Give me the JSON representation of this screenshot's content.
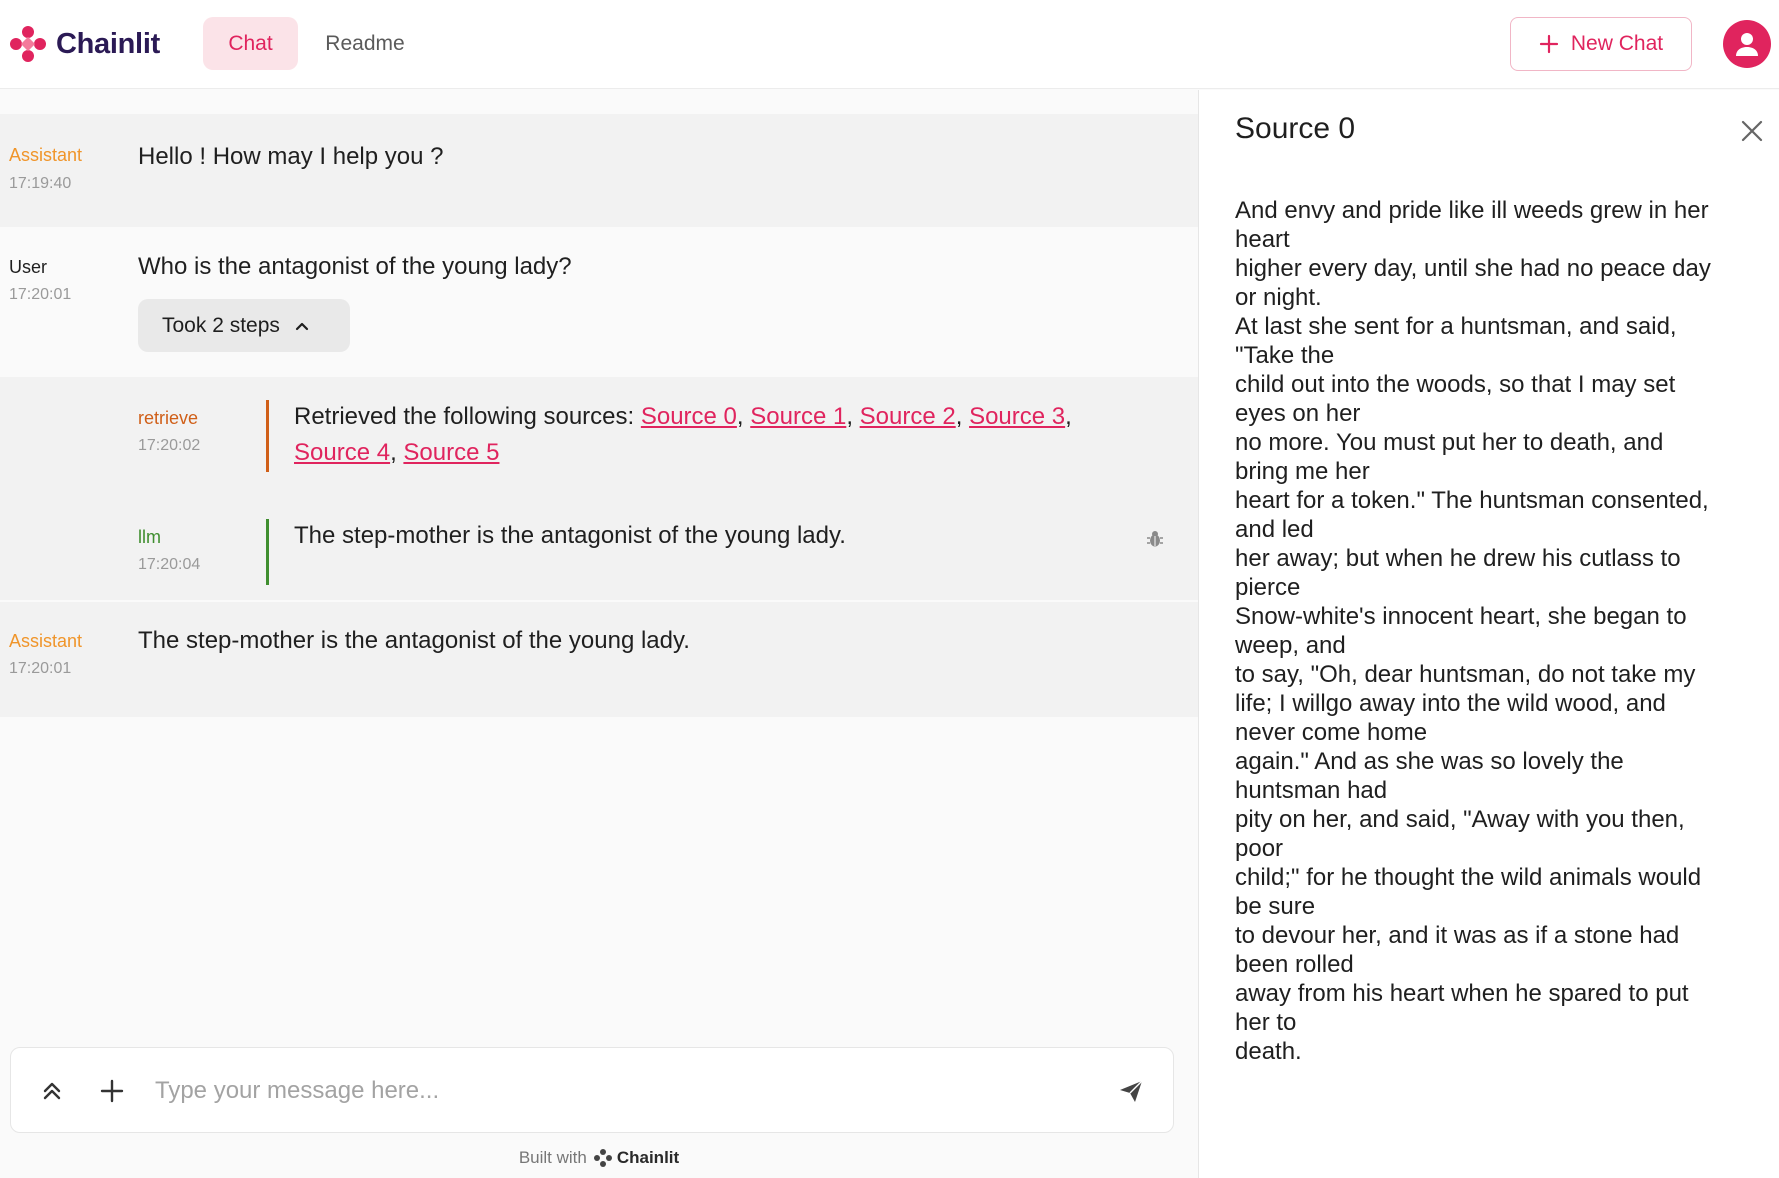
{
  "header": {
    "brand": "Chainlit",
    "tabs": [
      {
        "label": "Chat",
        "active": true
      },
      {
        "label": "Readme",
        "active": false
      }
    ],
    "new_chat_label": "New Chat"
  },
  "colors": {
    "accent": "#e0245e",
    "assistant_author": "#f0952a",
    "retrieve_author": "#d05f18",
    "llm_author": "#3f8e2f"
  },
  "messages": [
    {
      "author": "Assistant",
      "time": "17:19:40",
      "text": "Hello ! How may I help you ?"
    },
    {
      "author": "User",
      "time": "17:20:01",
      "text": "Who is the antagonist of the young lady?",
      "steps_label": "Took 2 steps"
    },
    {
      "author": "Assistant",
      "time": "17:20:01",
      "text": "The step-mother is the antagonist of the young lady."
    }
  ],
  "steps": [
    {
      "author": "retrieve",
      "time": "17:20:02",
      "prefix": "Retrieved the following sources:",
      "sources": [
        "Source 0",
        "Source 1",
        "Source 2",
        "Source 3",
        "Source 4",
        "Source 5"
      ]
    },
    {
      "author": "llm",
      "time": "17:20:04",
      "text": "The step-mother is the antagonist of the young lady.",
      "icon": "bug-icon"
    }
  ],
  "composer": {
    "placeholder": "Type your message here...",
    "value": ""
  },
  "footer": {
    "prefix": "Built with",
    "brand": "Chainlit"
  },
  "side_panel": {
    "title": "Source 0",
    "text": "And envy and pride like ill weeds grew in her\nheart\nhigher every day, until she had no peace day\nor night.\nAt last she sent for a huntsman, and said,\n\"Take the\nchild out into the woods, so that I may set\neyes on her\nno more. You must put her to death, and\nbring me her\nheart for a token.\" The huntsman consented,\nand led\nher away; but when he drew his cutlass to\npierce\nSnow-white's innocent heart, she began to\nweep, and\nto say, \"Oh, dear huntsman, do not take my\nlife; I willgo away into the wild wood, and\nnever come home\nagain.\" And as she was so lovely the\nhuntsman had\npity on her, and said, \"Away with you then,\npoor\nchild;\" for he thought the wild animals would\nbe sure\nto devour her, and it was as if a stone had\nbeen rolled\naway from his heart when he spared to put\nher to\ndeath."
  }
}
